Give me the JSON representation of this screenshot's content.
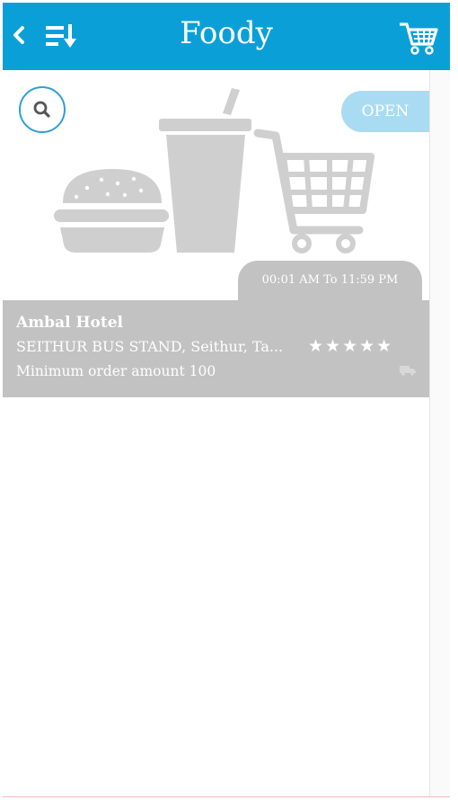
{
  "header": {
    "title": "Foody",
    "back_icon": "chevron-left-icon",
    "sort_icon": "sort-down-icon",
    "cart_icon": "cart-icon"
  },
  "restaurant": {
    "status": "OPEN",
    "hours": "00:01 AM To 11:59 PM",
    "name": "Ambal Hotel",
    "address": "SEITHUR BUS STAND, Seithur, Ta...",
    "min_order": "Minimum order amount 100",
    "rating": 5,
    "rating_display": "★★★★★",
    "delivery_icon": "truck-icon"
  },
  "colors": {
    "header": "#0aa0d7",
    "card_info": "#c2c2c2",
    "open_badge": "#a9dcf3",
    "search_ring": "#2e9fd6"
  }
}
